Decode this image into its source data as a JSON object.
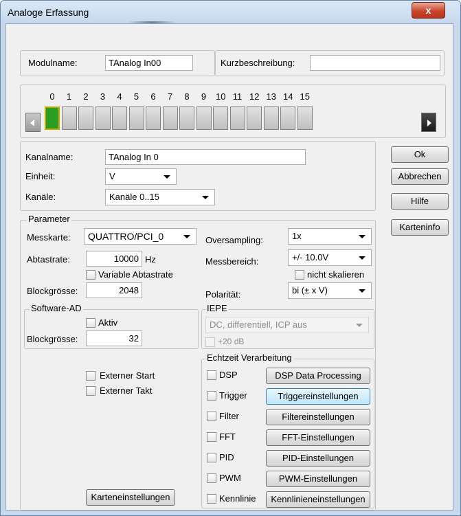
{
  "window": {
    "title": "Analoge Erfassung",
    "close_label": "x"
  },
  "module": {
    "name_label": "Modulname:",
    "name_value": "TAnalog In00",
    "desc_label": "Kurzbeschreibung:",
    "desc_value": ""
  },
  "channels": {
    "numbers": [
      "0",
      "1",
      "2",
      "3",
      "4",
      "5",
      "6",
      "7",
      "8",
      "9",
      "10",
      "11",
      "12",
      "13",
      "14",
      "15"
    ],
    "active_index": 0,
    "active_color": "#2a9e22"
  },
  "channel": {
    "name_label": "Kanalname:",
    "name_value": "TAnalog In 0",
    "unit_label": "Einheit:",
    "unit_value": "V",
    "channels_label": "Kanäle:",
    "channels_value": "Kanäle 0..15"
  },
  "side_buttons": {
    "ok": "Ok",
    "cancel": "Abbrechen",
    "help": "Hilfe",
    "cardinfo": "Karteninfo"
  },
  "parameter": {
    "legend": "Parameter",
    "card_label": "Messkarte:",
    "card_value": "QUATTRO/PCI_0",
    "rate_label": "Abtastrate:",
    "rate_value": "10000",
    "rate_unit": "Hz",
    "variable_rate_label": "Variable Abtastrate",
    "block_label": "Blockgrösse:",
    "block_value": "2048",
    "oversampling_label": "Oversampling:",
    "oversampling_value": "1x",
    "range_label": "Messbereich:",
    "range_value": "+/- 10.0V",
    "no_scale_label": "nicht skalieren",
    "polarity_label": "Polarität:",
    "polarity_value": "bi (± x V)"
  },
  "software_ad": {
    "legend": "Software-AD",
    "active_label": "Aktiv",
    "block_label": "Blockgrösse:",
    "block_value": "32"
  },
  "iepe": {
    "legend": "IEPE",
    "mode_value": "DC, differentiell, ICP aus",
    "db_label": "+20 dB"
  },
  "start": {
    "external_start": "Externer Start",
    "external_clock": "Externer Takt",
    "card_settings": "Karteneinstellungen"
  },
  "realtime": {
    "legend": "Echtzeit Verarbeitung",
    "rows": [
      {
        "check": "DSP",
        "button": "DSP Data Processing"
      },
      {
        "check": "Trigger",
        "button": "Triggereinstellungen"
      },
      {
        "check": "Filter",
        "button": "Filtereinstellungen"
      },
      {
        "check": "FFT",
        "button": "FFT-Einstellungen"
      },
      {
        "check": "PID",
        "button": "PID-Einstellungen"
      },
      {
        "check": "PWM",
        "button": "PWM-Einstellungen"
      },
      {
        "check": "Kennlinie",
        "button": "Kennlinieneinstellungen"
      }
    ]
  }
}
